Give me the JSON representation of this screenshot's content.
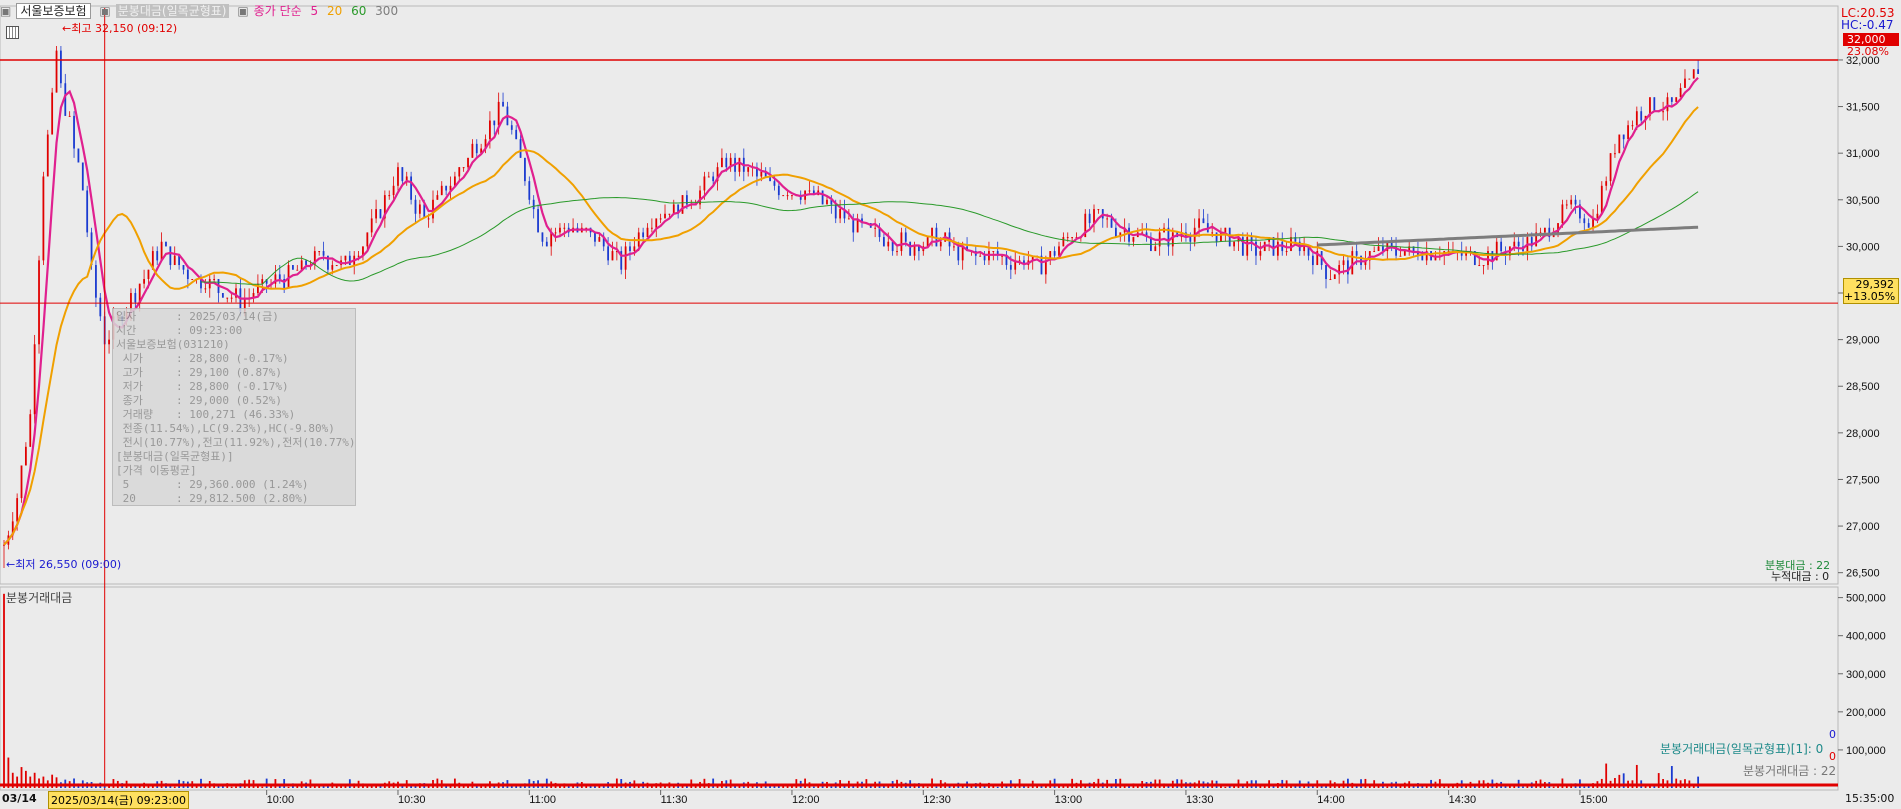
{
  "title_bar": {
    "stock_name": "서울보증보험",
    "indicator_name": "분봉대금(일목균형표)",
    "ma_label": "종가 단순",
    "ma_periods": [
      "5",
      "20",
      "60",
      "300"
    ],
    "ma_colors": [
      "#e0208f",
      "#f0a000",
      "#2a9a2a",
      "#7d7d7d"
    ]
  },
  "high_marker": {
    "text": "최고 32,150 (09:12)",
    "color": "#e00000"
  },
  "low_marker": {
    "text": "최저 26,550 (09:00)",
    "color": "#1a1ad0"
  },
  "right_labels": {
    "lc": "LC:20.53",
    "hc": "HC:-0.47",
    "limit_price": "32,000",
    "limit_pct": "23.08%",
    "cursor_price": "29,392",
    "cursor_pct": "+13.05%",
    "indicator_small_1": "분봉대금 : 22",
    "indicator_small_2": "누적대금 : 0",
    "vol_legend_1": "분봉거래대금(일목균형표)[1]: 0",
    "vol_legend_2": "분봉거래대금 : 22",
    "vol_zero_blue": "0",
    "vol_zero_red": "0"
  },
  "volume_panel": {
    "title": "분봉거래대금"
  },
  "hover_info": {
    "rows": [
      {
        "k": "일자",
        "v": ": 2025/03/14(금)"
      },
      {
        "k": "시간",
        "v": ": 09:23:00"
      },
      {
        "k": "서울보증보험(031210)",
        "v": ""
      },
      {
        "k": " 시가",
        "v": ": 28,800 (-0.17%)"
      },
      {
        "k": " 고가",
        "v": ": 29,100 (0.87%)"
      },
      {
        "k": " 저가",
        "v": ": 28,800 (-0.17%)"
      },
      {
        "k": " 종가",
        "v": ": 29,000 (0.52%)"
      },
      {
        "k": " 거래량",
        "v": ": 100,271 (46.33%)"
      },
      {
        "k": " 전종(11.54%),LC(9.23%),HC(-9.80%)",
        "v": ""
      },
      {
        "k": " 전시(10.77%),전고(11.92%),전저(10.77%)",
        "v": ""
      },
      {
        "k": "[분봉대금(일목균형표)]",
        "v": ""
      },
      {
        "k": "[가격 이동평균]",
        "v": ""
      },
      {
        "k": " 5",
        "v": ": 29,360.000 (1.24%)"
      },
      {
        "k": " 20",
        "v": ": 29,812.500 (2.80%)"
      }
    ]
  },
  "x_axis": {
    "date_label": "03/14",
    "cursor_label": "2025/03/14(금) 09:23:00",
    "end_label": "15:35:00"
  },
  "chart_data": [
    {
      "type": "candlestick",
      "title": "서울보증보험",
      "x_time_labels": [
        "10:00",
        "10:30",
        "11:00",
        "11:30",
        "12:00",
        "12:30",
        "13:00",
        "13:30",
        "14:00",
        "14:30",
        "15:00"
      ],
      "y_tick_labels": [
        "32,000",
        "31,500",
        "31,000",
        "30,500",
        "30,000",
        "29,500",
        "29,000",
        "28,500",
        "28,000",
        "27,500",
        "27,000",
        "26,500"
      ],
      "ylim": [
        26400,
        32450
      ],
      "open": 26800,
      "high": 32150,
      "high_time": "09:12",
      "low": 26550,
      "low_time": "09:00",
      "limit_line": 32000,
      "cursor_time": "09:23",
      "cursor_price": 29392,
      "closes_anchor": [
        [
          "09:00",
          26800
        ],
        [
          "09:03",
          27300
        ],
        [
          "09:06",
          28200
        ],
        [
          "09:09",
          30800
        ],
        [
          "09:12",
          31900
        ],
        [
          "09:15",
          31300
        ],
        [
          "09:18",
          30600
        ],
        [
          "09:20",
          29700
        ],
        [
          "09:23",
          29000
        ],
        [
          "09:30",
          29500
        ],
        [
          "09:36",
          30000
        ],
        [
          "09:42",
          29700
        ],
        [
          "09:48",
          29600
        ],
        [
          "09:54",
          29400
        ],
        [
          "10:00",
          29600
        ],
        [
          "10:06",
          29700
        ],
        [
          "10:12",
          29900
        ],
        [
          "10:18",
          29800
        ],
        [
          "10:24",
          30200
        ],
        [
          "10:30",
          30800
        ],
        [
          "10:36",
          30300
        ],
        [
          "10:42",
          30700
        ],
        [
          "10:48",
          31100
        ],
        [
          "10:54",
          31500
        ],
        [
          "10:58",
          30900
        ],
        [
          "11:03",
          30100
        ],
        [
          "11:09",
          30200
        ],
        [
          "11:15",
          30100
        ],
        [
          "11:21",
          29800
        ],
        [
          "11:27",
          30300
        ],
        [
          "11:33",
          30400
        ],
        [
          "11:39",
          30600
        ],
        [
          "11:45",
          30900
        ],
        [
          "11:51",
          30800
        ],
        [
          "11:57",
          30600
        ],
        [
          "12:03",
          30600
        ],
        [
          "12:09",
          30400
        ],
        [
          "12:15",
          30200
        ],
        [
          "12:21",
          30100
        ],
        [
          "12:27",
          30000
        ],
        [
          "12:33",
          30100
        ],
        [
          "12:39",
          29900
        ],
        [
          "12:45",
          29900
        ],
        [
          "12:51",
          29850
        ],
        [
          "12:57",
          29800
        ],
        [
          "13:03",
          30100
        ],
        [
          "13:09",
          30300
        ],
        [
          "13:15",
          30200
        ],
        [
          "13:21",
          30050
        ],
        [
          "13:27",
          30100
        ],
        [
          "13:33",
          30200
        ],
        [
          "13:39",
          30100
        ],
        [
          "13:45",
          29950
        ],
        [
          "13:51",
          30000
        ],
        [
          "13:57",
          30000
        ],
        [
          "14:03",
          29700
        ],
        [
          "14:09",
          29850
        ],
        [
          "14:15",
          29950
        ],
        [
          "14:21",
          29950
        ],
        [
          "14:27",
          29950
        ],
        [
          "14:33",
          29900
        ],
        [
          "14:39",
          29900
        ],
        [
          "14:45",
          30000
        ],
        [
          "14:51",
          30100
        ],
        [
          "14:57",
          30400
        ],
        [
          "15:03",
          30300
        ],
        [
          "15:09",
          31200
        ],
        [
          "15:15",
          31500
        ],
        [
          "15:21",
          31500
        ],
        [
          "15:27",
          31900
        ]
      ],
      "series": [
        {
          "name": "5",
          "color": "#e0208f"
        },
        {
          "name": "20",
          "color": "#f0a000"
        },
        {
          "name": "60",
          "color": "#2a9a2a"
        },
        {
          "name": "300",
          "color": "#7d7d7d"
        }
      ]
    },
    {
      "type": "bar",
      "title": "분봉거래대금",
      "y_tick_labels": [
        "500,000",
        "400,000",
        "300,000",
        "200,000",
        "100,000"
      ],
      "ylim": [
        0,
        520000
      ],
      "first_bars": [
        510000,
        80000,
        40000,
        30000,
        55000,
        45000,
        30000,
        40000,
        25000,
        30000,
        20000,
        35000,
        28000,
        15000,
        22000,
        18000,
        25000,
        12000,
        20000,
        15000
      ]
    }
  ]
}
